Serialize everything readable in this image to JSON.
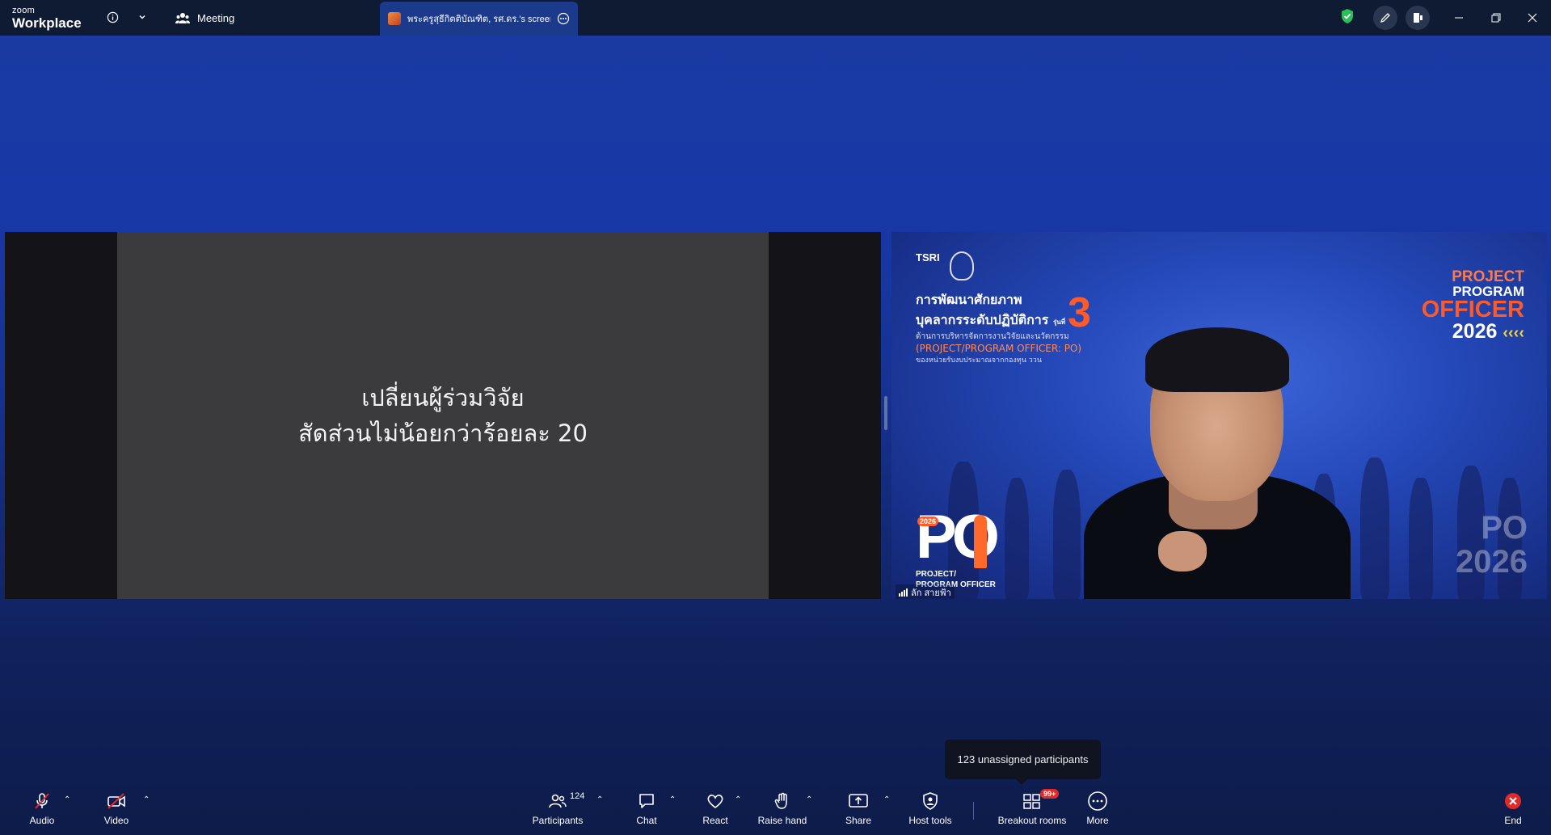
{
  "titlebar": {
    "logo_top": "zoom",
    "logo_bottom": "Workplace",
    "meeting_label": "Meeting",
    "share_tab_label": "พระครูสุธีกิตติบัณฑิต, รศ.ดร.'s screen"
  },
  "shared_slide": {
    "line1": "เปลี่ยนผู้ร่วมวิจัย",
    "line2": "สัดส่วนไม่น้อยกว่าร้อยละ 20"
  },
  "speaker": {
    "name": "ลัก สายฟ้า",
    "banner": {
      "tsri": "TSRI",
      "line1": "การพัฒนาศักยภาพ",
      "line2": "บุคลากรระดับปฏิบัติการ",
      "line2_small": "รุ่นที่",
      "line3": "ด้านการบริหารจัดการงานวิจัยและนวัตกรรม",
      "line4": "(PROJECT/PROGRAM OFFICER: PO)",
      "line5": "ของหน่วยรับงบประมาณจากกองทุน ววน",
      "batch": "3",
      "right_l1": "PROJECT",
      "right_l2": "PROGRAM",
      "right_l3": "OFFICER",
      "right_l4": "2026",
      "po_year": "2026",
      "po_text": "PO",
      "po_sub1": "PROJECT/",
      "po_sub2": "PROGRAM OFFICER",
      "watermark1": "PO",
      "watermark2": "2026"
    }
  },
  "tooltip": "123 unassigned participants",
  "toolbar": {
    "audio": "Audio",
    "video": "Video",
    "participants": "Participants",
    "participants_count": "124",
    "chat": "Chat",
    "react": "React",
    "raise_hand": "Raise hand",
    "share": "Share",
    "host_tools": "Host tools",
    "breakout_rooms": "Breakout rooms",
    "breakout_badge": "99+",
    "more": "More",
    "end": "End"
  },
  "colors": {
    "titlebar_bg": "#0f1a33",
    "accent_red": "#e02a2a",
    "shield_green": "#2bbf5a",
    "slide_bg": "#3b3b3e"
  }
}
